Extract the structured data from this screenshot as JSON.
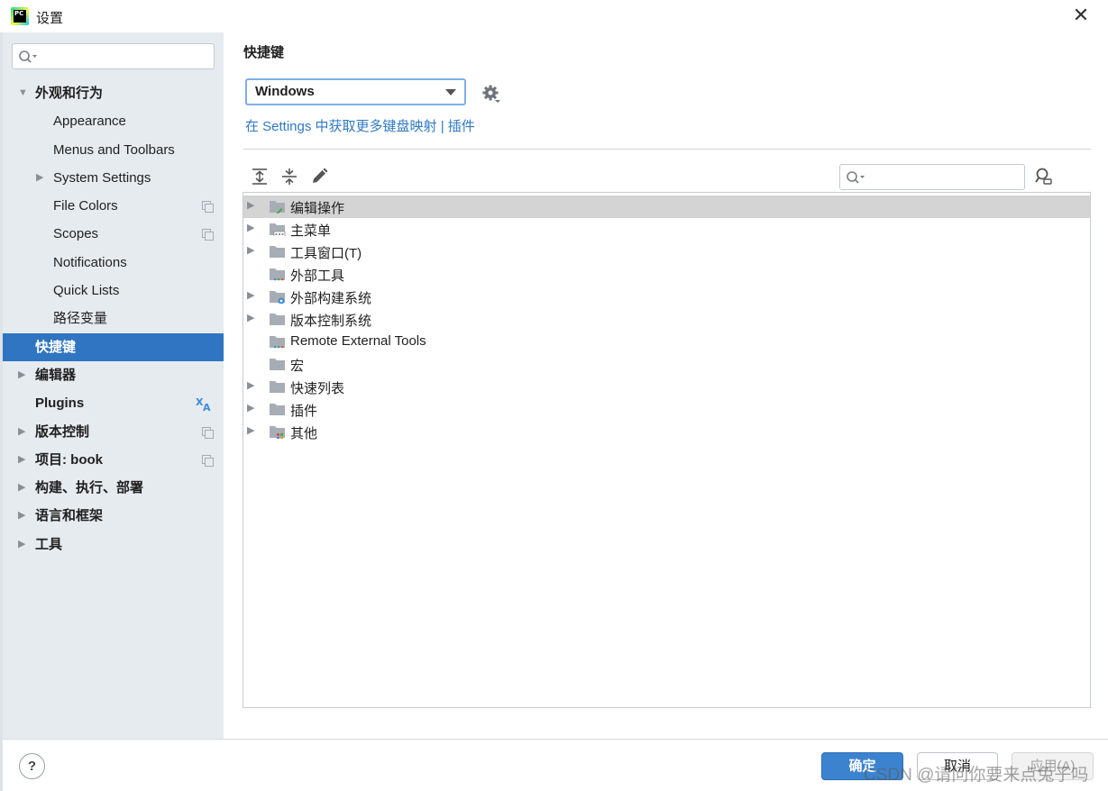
{
  "window": {
    "title": "设置",
    "app_icon_text": "PC"
  },
  "sidebar": {
    "search_placeholder": "",
    "items": [
      {
        "label": "外观和行为",
        "arrow": "▼",
        "bold": true,
        "indent": 0,
        "expanded": true
      },
      {
        "label": "Appearance",
        "arrow": "",
        "bold": false,
        "indent": 1
      },
      {
        "label": "Menus and Toolbars",
        "arrow": "",
        "bold": false,
        "indent": 1
      },
      {
        "label": "System Settings",
        "arrow": "▶",
        "bold": false,
        "indent": 1
      },
      {
        "label": "File Colors",
        "arrow": "",
        "bold": false,
        "indent": 1,
        "project_icon": true
      },
      {
        "label": "Scopes",
        "arrow": "",
        "bold": false,
        "indent": 1,
        "project_icon": true
      },
      {
        "label": "Notifications",
        "arrow": "",
        "bold": false,
        "indent": 1
      },
      {
        "label": "Quick Lists",
        "arrow": "",
        "bold": false,
        "indent": 1
      },
      {
        "label": "路径变量",
        "arrow": "",
        "bold": false,
        "indent": 1
      },
      {
        "label": "快捷键",
        "arrow": "",
        "bold": true,
        "indent": 0,
        "selected": true
      },
      {
        "label": "编辑器",
        "arrow": "▶",
        "bold": true,
        "indent": 0
      },
      {
        "label": "Plugins",
        "arrow": "",
        "bold": true,
        "indent": 0,
        "translate_icon": true
      },
      {
        "label": "版本控制",
        "arrow": "▶",
        "bold": true,
        "indent": 0,
        "project_icon": true
      },
      {
        "label": "项目: book",
        "arrow": "▶",
        "bold": true,
        "indent": 0,
        "project_icon": true
      },
      {
        "label": "构建、执行、部署",
        "arrow": "▶",
        "bold": true,
        "indent": 0
      },
      {
        "label": "语言和框架",
        "arrow": "▶",
        "bold": true,
        "indent": 0
      },
      {
        "label": "工具",
        "arrow": "▶",
        "bold": true,
        "indent": 0
      }
    ]
  },
  "main": {
    "title": "快捷键",
    "keymap_value": "Windows",
    "more_link": {
      "prefix": "在 Settings 中获取更多键盘映射",
      "separator": " | ",
      "plugins": "插件"
    },
    "tree_search_placeholder": "",
    "tree": [
      {
        "label": "编辑操作",
        "expandable": true,
        "selected": true,
        "badge": "edit"
      },
      {
        "label": "主菜单",
        "expandable": true,
        "badge": "menu"
      },
      {
        "label": "工具窗口(T)",
        "expandable": true,
        "badge": "none"
      },
      {
        "label": "外部工具",
        "expandable": false,
        "badge": "dots"
      },
      {
        "label": "外部构建系统",
        "expandable": true,
        "badge": "gear"
      },
      {
        "label": "版本控制系统",
        "expandable": true,
        "badge": "none"
      },
      {
        "label": "Remote External Tools",
        "expandable": false,
        "badge": "dots"
      },
      {
        "label": "宏",
        "expandable": false,
        "badge": "none"
      },
      {
        "label": "快速列表",
        "expandable": true,
        "badge": "none"
      },
      {
        "label": "插件",
        "expandable": true,
        "badge": "none"
      },
      {
        "label": "其他",
        "expandable": true,
        "badge": "other"
      }
    ]
  },
  "footer": {
    "help": "?",
    "ok": "确定",
    "cancel": "取消",
    "apply": "应用(A)",
    "watermark": "CSDN @请问你要来点兔子吗"
  },
  "colors": {
    "selected_sidebar": "#2f75c1",
    "link": "#2e79c5",
    "ok_button": "#3c83cf",
    "sidebar_bg": "#e6ebf0"
  }
}
